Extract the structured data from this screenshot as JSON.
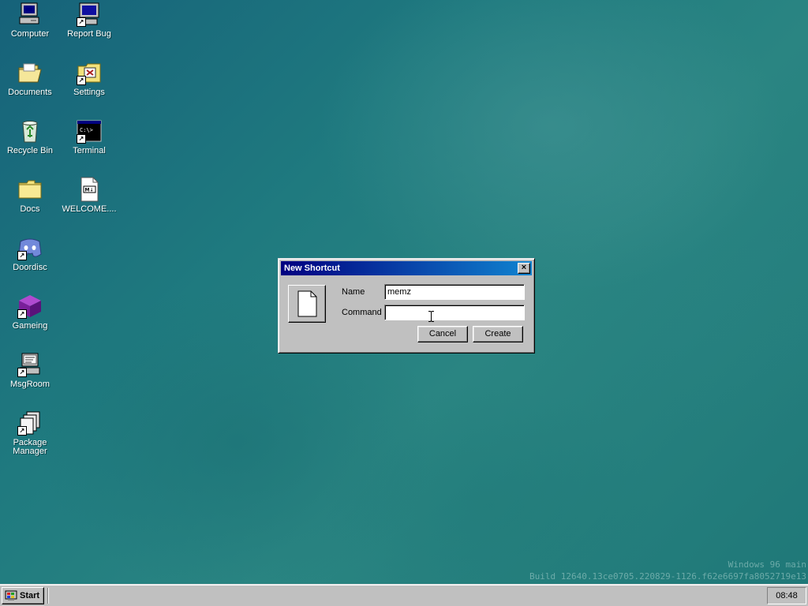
{
  "desktop": {
    "icons": [
      {
        "label": "Computer",
        "icon": "computer-icon"
      },
      {
        "label": "Report Bug",
        "icon": "monitor-shortcut-icon"
      },
      {
        "label": "Documents",
        "icon": "open-folder-icon"
      },
      {
        "label": "Settings",
        "icon": "settings-icon"
      },
      {
        "label": "Recycle Bin",
        "icon": "recycle-bin-icon"
      },
      {
        "label": "Terminal",
        "icon": "terminal-icon"
      },
      {
        "label": "Docs",
        "icon": "folder-icon"
      },
      {
        "label": "WELCOME....",
        "icon": "markdown-file-icon"
      },
      {
        "label": "Doordisc",
        "icon": "discord-icon"
      },
      {
        "label": "Gameing",
        "icon": "purple-cube-icon"
      },
      {
        "label": "MsgRoom",
        "icon": "msgroom-icon"
      },
      {
        "label": "Package Manager",
        "icon": "package-manager-icon"
      }
    ],
    "watermark": {
      "line1": "Windows 96 main",
      "line2": "Build 12640.13ce0705.220829-1126.f62e6697fa8052719e13"
    },
    "colors": {
      "background": "#1f7a7f",
      "title_gradient_start": "#000080",
      "title_gradient_end": "#1084d0"
    }
  },
  "dialog": {
    "title": "New Shortcut",
    "close_glyph": "×",
    "icon": "blank-document-icon",
    "name_label": "Name",
    "name_value": "memz",
    "command_label": "Command",
    "command_value": "",
    "cancel_label": "Cancel",
    "create_label": "Create"
  },
  "taskbar": {
    "start_label": "Start",
    "clock": "08:48"
  }
}
